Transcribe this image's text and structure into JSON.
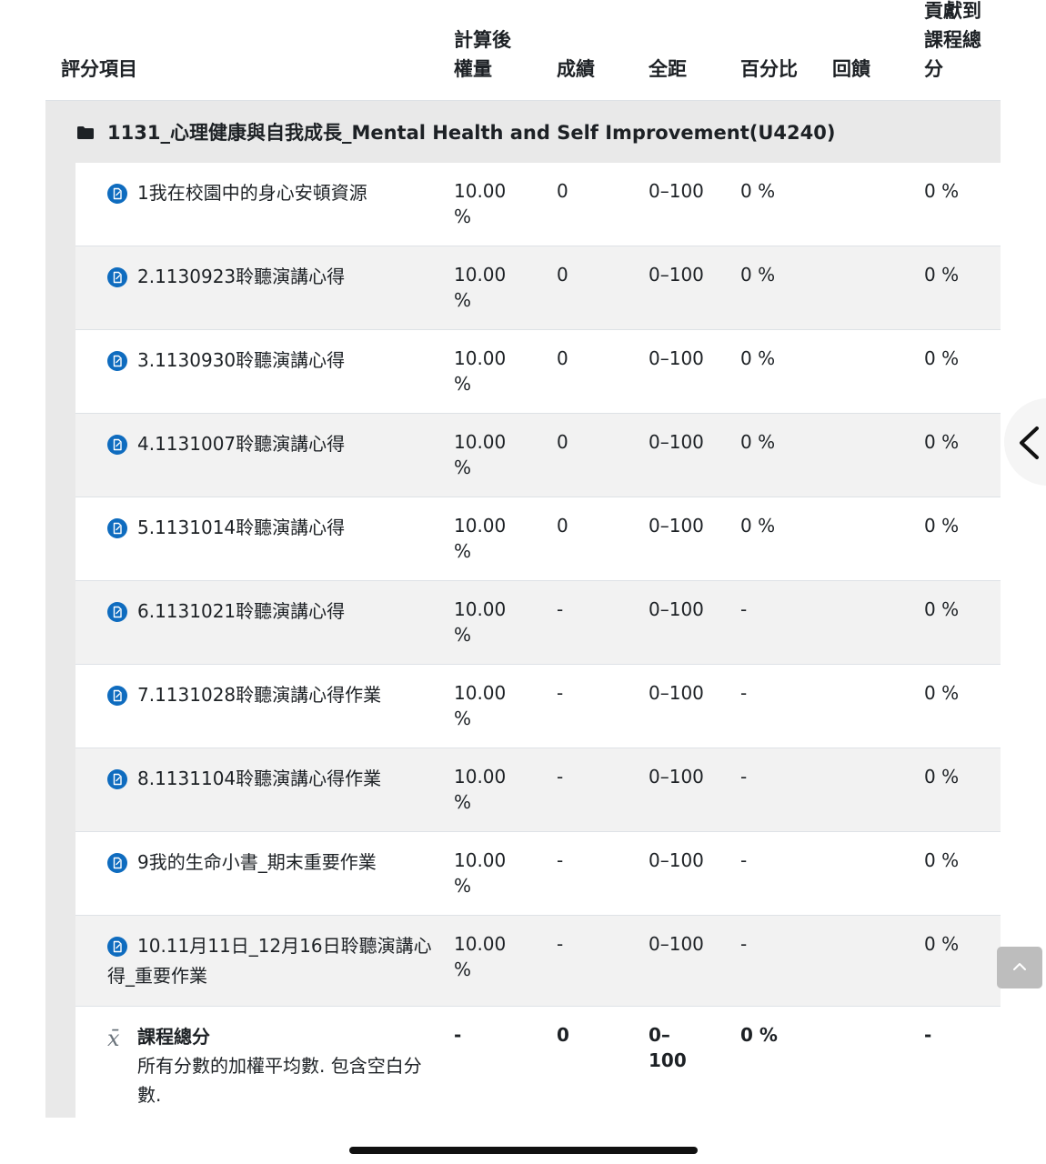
{
  "headers": {
    "item": "評分項目",
    "weight": "計算後\n權量",
    "grade": "成績",
    "range": "全距",
    "percentage": "百分比",
    "feedback": "回饋",
    "contribution": "貢獻到\n課程總\n分"
  },
  "category": {
    "title": "1131_心理健康與自我成長_Mental Health and Self Improvement(U4240)",
    "icon": "folder-icon"
  },
  "item_icon": "assignment-icon",
  "rows": [
    {
      "name": "1我在校園中的身心安頓資源",
      "weight": "10.00 %",
      "grade": "0",
      "range": "0–100",
      "percentage": "0 %",
      "contribution": "0 %"
    },
    {
      "name": "2.1130923聆聽演講心得",
      "weight": "10.00 %",
      "grade": "0",
      "range": "0–100",
      "percentage": "0 %",
      "contribution": "0 %"
    },
    {
      "name": "3.1130930聆聽演講心得",
      "weight": "10.00 %",
      "grade": "0",
      "range": "0–100",
      "percentage": "0 %",
      "contribution": "0 %"
    },
    {
      "name": "4.1131007聆聽演講心得",
      "weight": "10.00 %",
      "grade": "0",
      "range": "0–100",
      "percentage": "0 %",
      "contribution": "0 %"
    },
    {
      "name": "5.1131014聆聽演講心得",
      "weight": "10.00 %",
      "grade": "0",
      "range": "0–100",
      "percentage": "0 %",
      "contribution": "0 %"
    },
    {
      "name": "6.1131021聆聽演講心得",
      "weight": "10.00 %",
      "grade": "-",
      "range": "0–100",
      "percentage": "-",
      "contribution": "0 %"
    },
    {
      "name": "7.1131028聆聽演講心得作業",
      "weight": "10.00 %",
      "grade": "-",
      "range": "0–100",
      "percentage": "-",
      "contribution": "0 %"
    },
    {
      "name": "8.1131104聆聽演講心得作業",
      "weight": "10.00 %",
      "grade": "-",
      "range": "0–100",
      "percentage": "-",
      "contribution": "0 %"
    },
    {
      "name": "9我的生命小書_期末重要作業",
      "weight": "10.00 %",
      "grade": "-",
      "range": "0–100",
      "percentage": "-",
      "contribution": "0 %"
    },
    {
      "name": "10.11月11日_12月16日聆聽演講心得_重要作業",
      "weight": "10.00 %",
      "grade": "-",
      "range": "0–100",
      "percentage": "-",
      "contribution": "0 %"
    }
  ],
  "total": {
    "icon": "sigma-icon",
    "name": "課程總分",
    "description": "所有分數的加權平均數. 包含空白分數.",
    "weight": "-",
    "grade": "0",
    "range": "0–100",
    "percentage": "0 %",
    "contribution": "-"
  },
  "colors": {
    "accent": "#0f6cbf",
    "category_bg": "#e9e9e9",
    "alt_row_bg": "#f2f2f2"
  }
}
